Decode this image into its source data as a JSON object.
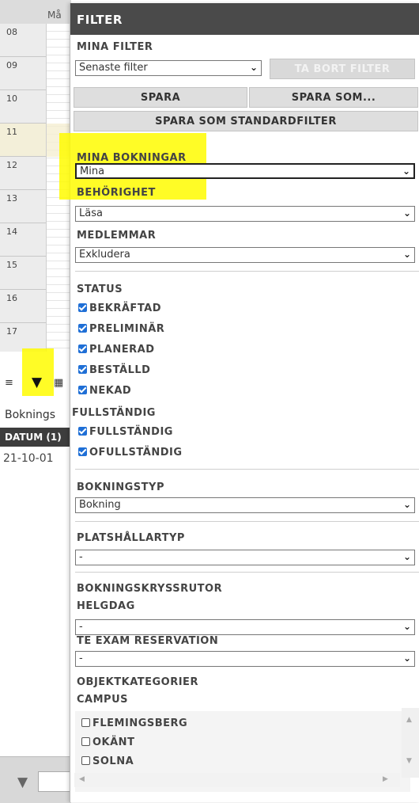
{
  "calendar": {
    "day_header": "Må",
    "hours": [
      "08",
      "09",
      "10",
      "11",
      "12",
      "13",
      "14",
      "15",
      "16",
      "17"
    ],
    "toolbar_label": "Boknings",
    "column_header": "DATUM (1)",
    "row_date": "21-10-01"
  },
  "filter": {
    "title": "FILTER",
    "my_filters_label": "MINA FILTER",
    "my_filters_value": "Senaste filter",
    "remove_filter": "TA BORT FILTER",
    "save": "SPARA",
    "save_as": "SPARA SOM...",
    "save_default": "SPARA SOM STANDARDFILTER",
    "my_bookings_label": "MINA BOKNINGAR",
    "my_bookings_value": "Mina",
    "permission_label": "BEHÖRIGHET",
    "permission_value": "Läsa",
    "members_label": "MEDLEMMAR",
    "members_value": "Exkludera",
    "status_label": "STATUS",
    "status_items": [
      "BEKRÄFTAD",
      "PRELIMINÄR",
      "PLANERAD",
      "BESTÄLLD",
      "NEKAD"
    ],
    "complete_label": "FULLSTÄNDIG",
    "complete_items": [
      "FULLSTÄNDIG",
      "OFULLSTÄNDIG"
    ],
    "booking_type_label": "BOKNINGSTYP",
    "booking_type_value": "Bokning",
    "placeholder_type_label": "PLATSHÅLLARTYP",
    "placeholder_type_value": "-",
    "booking_checkboxes_label": "BOKNINGSKRYSSRUTOR",
    "holiday_label": "HELGDAG",
    "holiday_value": "-",
    "exam_label": "TE EXAM RESERVATION",
    "exam_value": "-",
    "object_categories_label": "OBJEKTKATEGORIER",
    "campus_label": "CAMPUS",
    "campus_items": [
      "FLEMINGSBERG",
      "OKÄNT",
      "SOLNA"
    ]
  },
  "colors": {
    "checkbox_accent": "#1f6fd6",
    "highlight": "#fffb00",
    "header_bg": "#4a4a4a"
  }
}
